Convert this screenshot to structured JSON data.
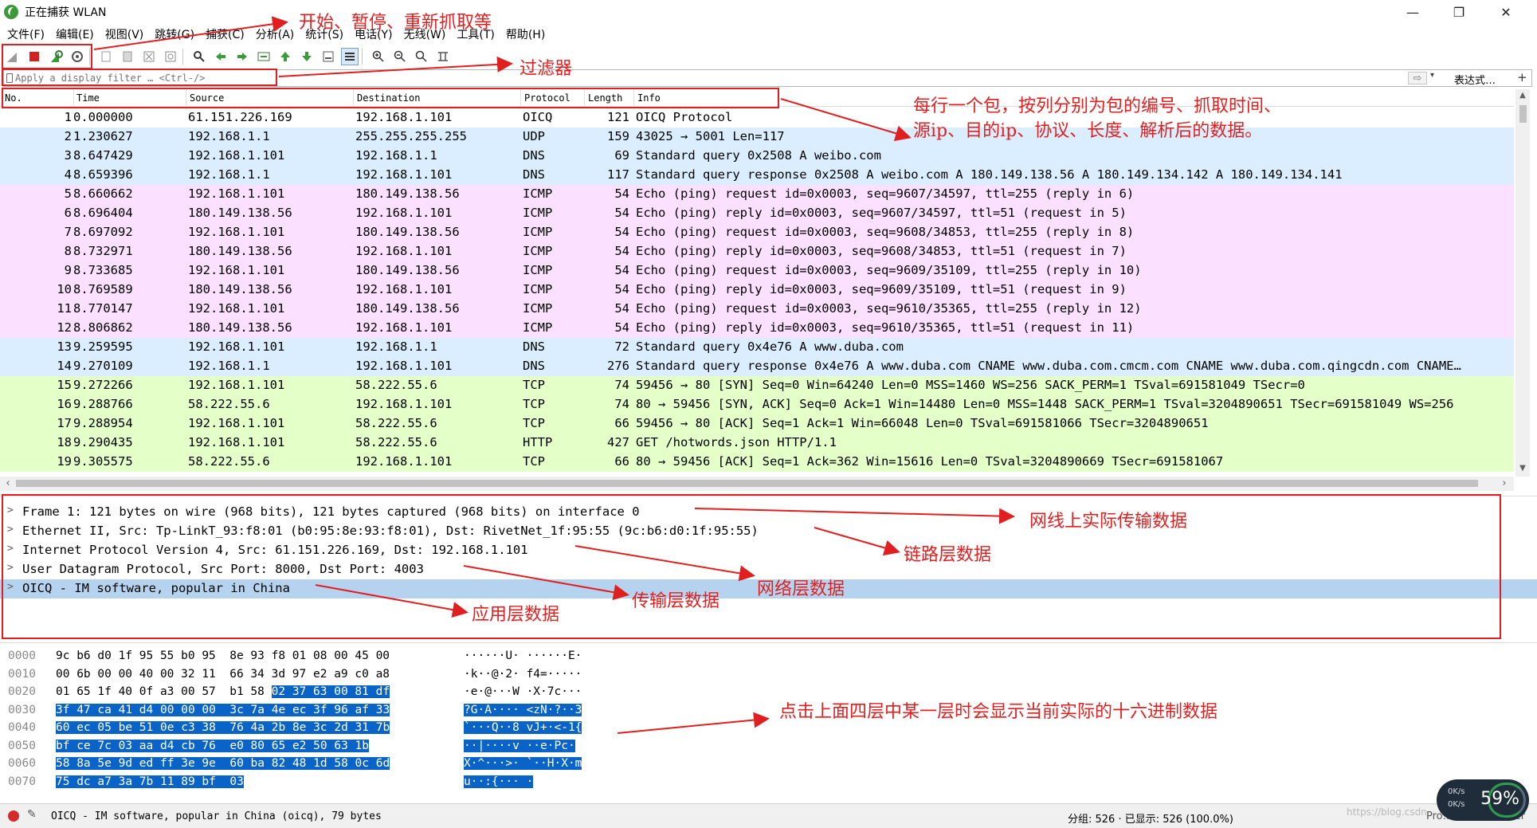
{
  "window": {
    "title": "正在捕获 WLAN",
    "minimize": "—",
    "maximize": "❐",
    "close": "✕"
  },
  "menu": [
    "文件(F)",
    "编辑(E)",
    "视图(V)",
    "跳转(G)",
    "捕获(C)",
    "分析(A)",
    "统计(S)",
    "电话(Y)",
    "无线(W)",
    "工具(T)",
    "帮助(H)"
  ],
  "toolbar": {
    "icons": [
      "shark-fin-start-icon",
      "stop-square-icon",
      "restart-capture-icon",
      "capture-options-gear-icon",
      "open-file-icon",
      "save-file-icon",
      "close-file-icon",
      "reload-file-icon",
      "find-packet-icon",
      "go-back-icon",
      "go-forward-icon",
      "go-to-packet-icon",
      "first-packet-icon",
      "last-packet-icon",
      "auto-scroll-icon",
      "colorize-icon",
      "zoom-in-icon",
      "zoom-out-icon",
      "normal-size-icon",
      "resize-columns-icon"
    ],
    "accent_stop": "#d62020",
    "accent_start": "#3a9a3a"
  },
  "filter": {
    "placeholder": "Apply a display filter … <Ctrl-/>",
    "arrow": "⇨",
    "dropdown": "▾",
    "expression_label": "表达式…",
    "add_label": "+"
  },
  "packet_list": {
    "columns": [
      "No.",
      "Time",
      "Source",
      "Destination",
      "Protocol",
      "Length",
      "Info"
    ],
    "row_colors": {
      "OICQ": "#ffffff",
      "UDP": "#daeeff",
      "DNS": "#daeeff",
      "ICMP": "#fce0ff",
      "TCP": "#e7e6ff",
      "TCP_HTTP": "#e4ffc7",
      "HTTP": "#e4ffc7"
    },
    "rows": [
      {
        "no": "1",
        "time": "0.000000",
        "src": "61.151.226.169",
        "dst": "192.168.1.101",
        "proto": "OICQ",
        "len": "121",
        "info": "OICQ Protocol",
        "color": "#ffffff"
      },
      {
        "no": "2",
        "time": "1.230627",
        "src": "192.168.1.1",
        "dst": "255.255.255.255",
        "proto": "UDP",
        "len": "159",
        "info": "43025 → 5001 Len=117",
        "color": "#daeeff"
      },
      {
        "no": "3",
        "time": "8.647429",
        "src": "192.168.1.101",
        "dst": "192.168.1.1",
        "proto": "DNS",
        "len": "69",
        "info": "Standard query 0x2508 A weibo.com",
        "color": "#daeeff"
      },
      {
        "no": "4",
        "time": "8.659396",
        "src": "192.168.1.1",
        "dst": "192.168.1.101",
        "proto": "DNS",
        "len": "117",
        "info": "Standard query response 0x2508 A weibo.com A 180.149.138.56 A 180.149.134.142 A 180.149.134.141",
        "color": "#daeeff"
      },
      {
        "no": "5",
        "time": "8.660662",
        "src": "192.168.1.101",
        "dst": "180.149.138.56",
        "proto": "ICMP",
        "len": "54",
        "info": "Echo (ping) request  id=0x0003, seq=9607/34597, ttl=255 (reply in 6)",
        "color": "#fce0ff"
      },
      {
        "no": "6",
        "time": "8.696404",
        "src": "180.149.138.56",
        "dst": "192.168.1.101",
        "proto": "ICMP",
        "len": "54",
        "info": "Echo (ping) reply    id=0x0003, seq=9607/34597, ttl=51 (request in 5)",
        "color": "#fce0ff"
      },
      {
        "no": "7",
        "time": "8.697092",
        "src": "192.168.1.101",
        "dst": "180.149.138.56",
        "proto": "ICMP",
        "len": "54",
        "info": "Echo (ping) request  id=0x0003, seq=9608/34853, ttl=255 (reply in 8)",
        "color": "#fce0ff"
      },
      {
        "no": "8",
        "time": "8.732971",
        "src": "180.149.138.56",
        "dst": "192.168.1.101",
        "proto": "ICMP",
        "len": "54",
        "info": "Echo (ping) reply    id=0x0003, seq=9608/34853, ttl=51 (request in 7)",
        "color": "#fce0ff"
      },
      {
        "no": "9",
        "time": "8.733685",
        "src": "192.168.1.101",
        "dst": "180.149.138.56",
        "proto": "ICMP",
        "len": "54",
        "info": "Echo (ping) request  id=0x0003, seq=9609/35109, ttl=255 (reply in 10)",
        "color": "#fce0ff"
      },
      {
        "no": "10",
        "time": "8.769589",
        "src": "180.149.138.56",
        "dst": "192.168.1.101",
        "proto": "ICMP",
        "len": "54",
        "info": "Echo (ping) reply    id=0x0003, seq=9609/35109, ttl=51 (request in 9)",
        "color": "#fce0ff"
      },
      {
        "no": "11",
        "time": "8.770147",
        "src": "192.168.1.101",
        "dst": "180.149.138.56",
        "proto": "ICMP",
        "len": "54",
        "info": "Echo (ping) request  id=0x0003, seq=9610/35365, ttl=255 (reply in 12)",
        "color": "#fce0ff"
      },
      {
        "no": "12",
        "time": "8.806862",
        "src": "180.149.138.56",
        "dst": "192.168.1.101",
        "proto": "ICMP",
        "len": "54",
        "info": "Echo (ping) reply    id=0x0003, seq=9610/35365, ttl=51 (request in 11)",
        "color": "#fce0ff"
      },
      {
        "no": "13",
        "time": "9.259595",
        "src": "192.168.1.101",
        "dst": "192.168.1.1",
        "proto": "DNS",
        "len": "72",
        "info": "Standard query 0x4e76 A www.duba.com",
        "color": "#daeeff"
      },
      {
        "no": "14",
        "time": "9.270109",
        "src": "192.168.1.1",
        "dst": "192.168.1.101",
        "proto": "DNS",
        "len": "276",
        "info": "Standard query response 0x4e76 A www.duba.com CNAME www.duba.com.cmcm.com CNAME www.duba.com.qingcdn.com CNAME…",
        "color": "#daeeff"
      },
      {
        "no": "15",
        "time": "9.272266",
        "src": "192.168.1.101",
        "dst": "58.222.55.6",
        "proto": "TCP",
        "len": "74",
        "info": "59456 → 80 [SYN] Seq=0 Win=64240 Len=0 MSS=1460 WS=256 SACK_PERM=1 TSval=691581049 TSecr=0",
        "color": "#e4ffc7"
      },
      {
        "no": "16",
        "time": "9.288766",
        "src": "58.222.55.6",
        "dst": "192.168.1.101",
        "proto": "TCP",
        "len": "74",
        "info": "80 → 59456 [SYN, ACK] Seq=0 Ack=1 Win=14480 Len=0 MSS=1448 SACK_PERM=1 TSval=3204890651 TSecr=691581049 WS=256",
        "color": "#e4ffc7"
      },
      {
        "no": "17",
        "time": "9.288954",
        "src": "192.168.1.101",
        "dst": "58.222.55.6",
        "proto": "TCP",
        "len": "66",
        "info": "59456 → 80 [ACK] Seq=1 Ack=1 Win=66048 Len=0 TSval=691581066 TSecr=3204890651",
        "color": "#e4ffc7"
      },
      {
        "no": "18",
        "time": "9.290435",
        "src": "192.168.1.101",
        "dst": "58.222.55.6",
        "proto": "HTTP",
        "len": "427",
        "info": "GET /hotwords.json HTTP/1.1",
        "color": "#e4ffc7"
      },
      {
        "no": "19",
        "time": "9.305575",
        "src": "58.222.55.6",
        "dst": "192.168.1.101",
        "proto": "TCP",
        "len": "66",
        "info": "80 → 59456 [ACK] Seq=1 Ack=362 Win=15616 Len=0 TSval=3204890669 TSecr=691581067",
        "color": "#e4ffc7"
      }
    ]
  },
  "detail": [
    "Frame 1: 121 bytes on wire (968 bits), 121 bytes captured (968 bits) on interface 0",
    "Ethernet II, Src: Tp-LinkT_93:f8:01 (b0:95:8e:93:f8:01), Dst: RivetNet_1f:95:55 (9c:b6:d0:1f:95:55)",
    "Internet Protocol Version 4, Src: 61.151.226.169, Dst: 192.168.1.101",
    "User Datagram Protocol, Src Port: 8000, Dst Port: 4003",
    "OICQ - IM software, popular in China"
  ],
  "hex": [
    {
      "off": "0000",
      "bytes": [
        "9c",
        "b6",
        "d0",
        "1f",
        "95",
        "55",
        "b0",
        "95",
        "8e",
        "93",
        "f8",
        "01",
        "08",
        "00",
        "45",
        "00"
      ],
      "ascii": "······U· ······E·",
      "hl_from": 16
    },
    {
      "off": "0010",
      "bytes": [
        "00",
        "6b",
        "00",
        "00",
        "40",
        "00",
        "32",
        "11",
        "66",
        "34",
        "3d",
        "97",
        "e2",
        "a9",
        "c0",
        "a8"
      ],
      "ascii": "·k··@·2· f4=·····",
      "hl_from": 16
    },
    {
      "off": "0020",
      "bytes": [
        "01",
        "65",
        "1f",
        "40",
        "0f",
        "a3",
        "00",
        "57",
        "b1",
        "58",
        "02",
        "37",
        "63",
        "00",
        "81",
        "df"
      ],
      "ascii": "·e·@···W ·X·7c···",
      "hl_from": 10
    },
    {
      "off": "0030",
      "bytes": [
        "3f",
        "47",
        "ca",
        "41",
        "d4",
        "00",
        "00",
        "00",
        "3c",
        "7a",
        "4e",
        "ec",
        "3f",
        "96",
        "af",
        "33"
      ],
      "ascii": "?G·A···· <zN·?··3",
      "hl_from": 0
    },
    {
      "off": "0040",
      "bytes": [
        "60",
        "ec",
        "05",
        "be",
        "51",
        "0e",
        "c3",
        "38",
        "76",
        "4a",
        "2b",
        "8e",
        "3c",
        "2d",
        "31",
        "7b"
      ],
      "ascii": "`···Q··8 vJ+·<-1{",
      "hl_from": 0
    },
    {
      "off": "0050",
      "bytes": [
        "bf",
        "ce",
        "7c",
        "03",
        "aa",
        "d4",
        "cb",
        "76",
        "e0",
        "80",
        "65",
        "e2",
        "50",
        "63",
        "1b"
      ],
      "ascii": "··|····v ··e·Pc·",
      "hl_from": 0
    },
    {
      "off": "0060",
      "bytes": [
        "58",
        "8a",
        "5e",
        "9d",
        "ed",
        "ff",
        "3e",
        "9e",
        "60",
        "ba",
        "82",
        "48",
        "1d",
        "58",
        "0c",
        "6d"
      ],
      "ascii": "X·^···>· `··H·X·m",
      "hl_from": 0
    },
    {
      "off": "0070",
      "bytes": [
        "75",
        "dc",
        "a7",
        "3a",
        "7b",
        "11",
        "89",
        "bf",
        "03"
      ],
      "ascii": "u··:{··· ·",
      "hl_from": 0
    }
  ],
  "status": {
    "selected_text": "OICQ - IM software, popular in China (oicq), 79 bytes",
    "packets_text": "分组: 526 · 已显示: 526 (100.0%)",
    "profile_text": "Pro…net/ACanswer",
    "net_up": "0K/s",
    "net_down": "0K/s",
    "cpu_percent": "59%",
    "watermark": "https://blog.csdn"
  },
  "annotations": {
    "color": "#e02020",
    "capture_controls": "开始、暂停、重新抓取等",
    "filter": "过滤器",
    "packet_list": "每行一个包，按列分别为包的编号、抓取时间、",
    "packet_list_2": "源ip、目的ip、协议、长度、解析后的数据。",
    "frame": "网线上实际传输数据",
    "link": "链路层数据",
    "network": "网络层数据",
    "transport": "传输层数据",
    "application": "应用层数据",
    "hex": "点击上面四层中某一层时会显示当前实际的十六进制数据"
  }
}
